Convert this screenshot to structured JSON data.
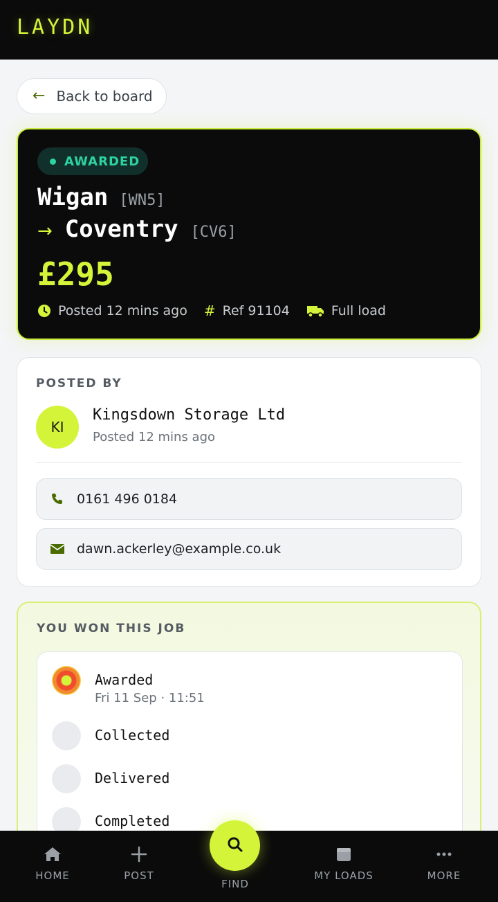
{
  "app": {
    "logo": "LAYDN"
  },
  "back_button": {
    "label": "Back to board"
  },
  "load": {
    "status": "AWARDED",
    "from_city": "Wigan",
    "from_code": "[WN5]",
    "to_city": "Coventry",
    "to_code": "[CV6]",
    "price": "£295",
    "posted": "Posted 12 mins ago",
    "ref": "Ref 91104",
    "load_type": "Full load"
  },
  "posted_by": {
    "title": "POSTED BY",
    "initials": "KI",
    "company": "Kingsdown Storage Ltd",
    "posted": "Posted 12 mins ago",
    "phone": "0161 496 0184",
    "email": "dawn.ackerley@example.co.uk"
  },
  "won": {
    "title": "YOU WON THIS JOB",
    "steps": [
      {
        "label": "Awarded",
        "time": "Fri 11 Sep · 11:51",
        "state": "active"
      },
      {
        "label": "Collected",
        "state": "pending"
      },
      {
        "label": "Delivered",
        "state": "pending"
      },
      {
        "label": "Completed",
        "state": "pending"
      }
    ]
  },
  "nav": {
    "home": "HOME",
    "post": "POST",
    "find": "FIND",
    "my_loads": "MY LOADS",
    "more": "MORE"
  },
  "colors": {
    "accent": "#d4f43a",
    "status": "#2ed3a4",
    "dark": "#0b0b0b"
  }
}
